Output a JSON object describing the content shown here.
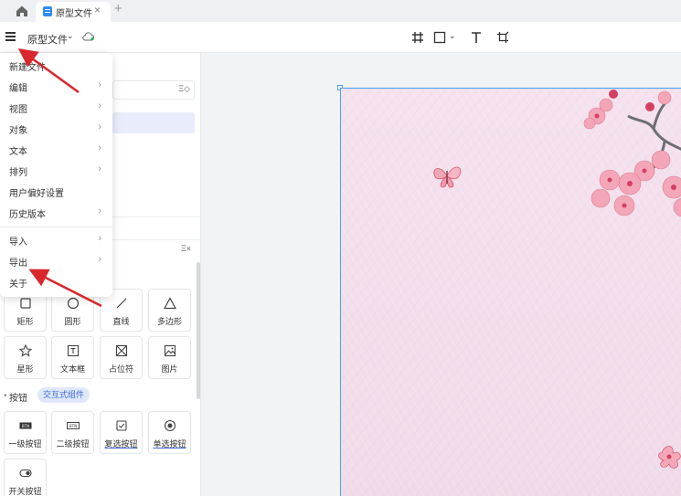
{
  "tab": {
    "label": "原型文件"
  },
  "toolbar": {
    "doc_title": "原型文件"
  },
  "menu": {
    "items": [
      {
        "label": "新建文件",
        "submenu": false
      },
      {
        "label": "编辑",
        "submenu": true
      },
      {
        "label": "视图",
        "submenu": true
      },
      {
        "label": "对象",
        "submenu": true
      },
      {
        "label": "文本",
        "submenu": true
      },
      {
        "label": "排列",
        "submenu": true
      },
      {
        "label": "用户偏好设置",
        "submenu": false
      },
      {
        "label": "历史版本",
        "submenu": true
      },
      {
        "label": "导入",
        "submenu": true
      },
      {
        "label": "导出",
        "submenu": true
      },
      {
        "label": "关于",
        "submenu": false
      }
    ]
  },
  "components": {
    "basic": [
      {
        "label": "矩形",
        "icon": "rectangle-icon"
      },
      {
        "label": "圆形",
        "icon": "circle-icon"
      },
      {
        "label": "直线",
        "icon": "line-icon"
      },
      {
        "label": "多边形",
        "icon": "polygon-icon"
      },
      {
        "label": "星形",
        "icon": "star-icon"
      },
      {
        "label": "文本框",
        "icon": "textbox-icon"
      },
      {
        "label": "占位符",
        "icon": "placeholder-icon"
      },
      {
        "label": "图片",
        "icon": "image-icon"
      }
    ],
    "section_title": "按钮",
    "badge": "交互式组件",
    "buttons": [
      {
        "label": "一级按钮",
        "icon": "primary-button-icon"
      },
      {
        "label": "二级按钮",
        "icon": "secondary-button-icon"
      },
      {
        "label": "复选按钮",
        "icon": "checkbox-icon"
      },
      {
        "label": "单选按钮",
        "icon": "radio-icon"
      },
      {
        "label": "开关按钮",
        "icon": "toggle-icon"
      }
    ]
  },
  "colors": {
    "accent": "#4a9ff0",
    "annotation_arrow": "#d9272e",
    "badge_bg": "#dfe8fb"
  }
}
